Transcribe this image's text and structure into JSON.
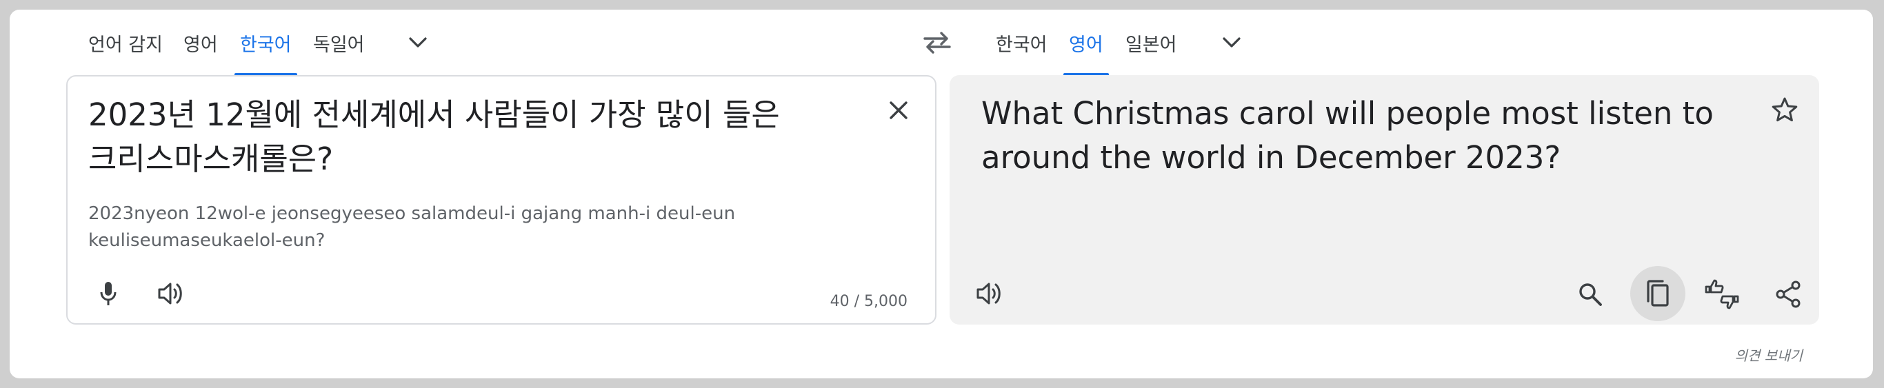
{
  "source_languages": {
    "tabs": [
      "언어 감지",
      "영어",
      "한국어",
      "독일어"
    ],
    "active_index": 2
  },
  "target_languages": {
    "tabs": [
      "한국어",
      "영어",
      "일본어"
    ],
    "active_index": 1
  },
  "source": {
    "text": "2023년 12월에 전세계에서 사람들이 가장 많이 들은 크리스마스캐롤은?",
    "romanization": "2023nyeon 12wol-e jeonsegyeeseo salamdeul-i gajang manh-i deul-eun keuliseumaseukaelol-eun?",
    "char_count": "40 / 5,000"
  },
  "target": {
    "text": "What Christmas carol will people most listen to around the world in December 2023?"
  },
  "footer": {
    "feedback_label": "의견 보내기"
  },
  "colors": {
    "accent": "#1a73e8",
    "text": "#202124",
    "muted": "#5f6368",
    "target_panel_bg": "#f1f1f1",
    "border": "#dadce0"
  },
  "icons": {
    "source_more": "chevron-down-icon",
    "swap": "swap-arrows-icon",
    "target_more": "chevron-down-icon",
    "clear": "close-icon",
    "star": "star-icon",
    "mic": "microphone-icon",
    "source_listen": "speaker-icon",
    "target_listen": "speaker-icon",
    "search": "search-icon",
    "copy": "copy-icon",
    "rate": "thumbs-up-down-icon",
    "share": "share-icon"
  }
}
